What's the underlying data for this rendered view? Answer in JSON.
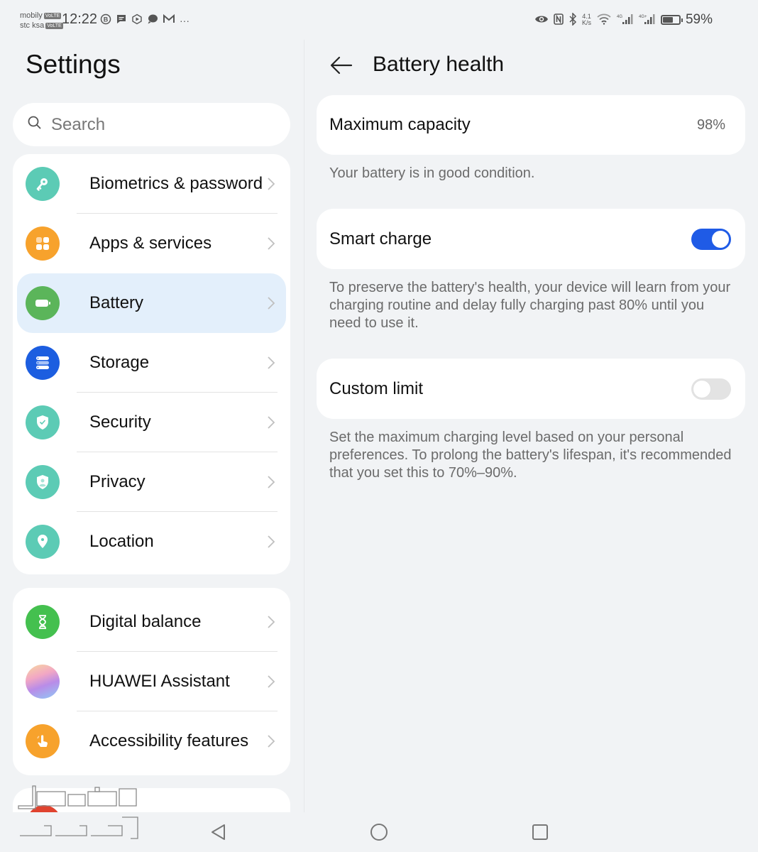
{
  "status_bar": {
    "carriers": [
      {
        "name": "mobily",
        "badge": "VoLTE"
      },
      {
        "name": "stc ksa",
        "badge": "VoLTE"
      }
    ],
    "time": "12:22",
    "notification_icons": [
      "business-icon",
      "message-icon",
      "browser-icon",
      "chat-bubble-icon",
      "gmail-icon",
      "more-icon"
    ],
    "more_glyph": "···",
    "system_icons": [
      "eye-comfort-icon",
      "nfc-icon",
      "bluetooth-icon",
      "wifi-icon",
      "signal-4g-icon",
      "signal-4g-plus-icon",
      "battery-icon"
    ],
    "net_speed_value": "4.1",
    "net_speed_unit": "K/s",
    "signal_labels": [
      "4G",
      "4G+"
    ],
    "battery_percent": "59%"
  },
  "left_pane": {
    "title": "Settings",
    "search": {
      "placeholder": "Search",
      "value": ""
    },
    "groups": [
      {
        "items": [
          {
            "label": "Biometrics & password",
            "icon": "key-icon",
            "color": "#5ccbb5"
          },
          {
            "label": "Apps & services",
            "icon": "apps-grid-icon",
            "color": "#f7a22c"
          },
          {
            "label": "Battery",
            "icon": "battery-icon",
            "color": "#5bb55a",
            "selected": true
          },
          {
            "label": "Storage",
            "icon": "storage-icon",
            "color": "#1c5ee0"
          },
          {
            "label": "Security",
            "icon": "shield-check-icon",
            "color": "#5ccbb5"
          },
          {
            "label": "Privacy",
            "icon": "privacy-shield-icon",
            "color": "#5ccbb5"
          },
          {
            "label": "Location",
            "icon": "location-pin-icon",
            "color": "#5ccbb5"
          }
        ]
      },
      {
        "items": [
          {
            "label": "Digital balance",
            "icon": "hourglass-icon",
            "color": "#44c04f"
          },
          {
            "label": "HUAWEI Assistant",
            "icon": "huawei-assistant-icon",
            "color": "#b9a6e8"
          },
          {
            "label": "Accessibility features",
            "icon": "hand-tap-icon",
            "color": "#f7a22c"
          }
        ]
      }
    ],
    "selected_highlight": "#e3effb"
  },
  "right_pane": {
    "title": "Battery health",
    "back_label": "Back",
    "maximum_capacity": {
      "label": "Maximum capacity",
      "value": "98%"
    },
    "condition_text": "Your battery is in good condition.",
    "smart_charge": {
      "label": "Smart charge",
      "enabled": true,
      "description": "To preserve the battery's health, your device will learn from your charging routine and delay fully charging past 80% until you need to use it."
    },
    "custom_limit": {
      "label": "Custom limit",
      "enabled": false,
      "description": "Set the maximum charging level based on your personal preferences. To prolong the battery's lifespan, it's recommended that you set this to 70%–90%."
    },
    "accent_color": "#1f5be6"
  },
  "nav_bar": {
    "buttons": [
      "back",
      "home",
      "recents"
    ]
  },
  "watermark": {
    "text": "مستعمل وجديد"
  }
}
